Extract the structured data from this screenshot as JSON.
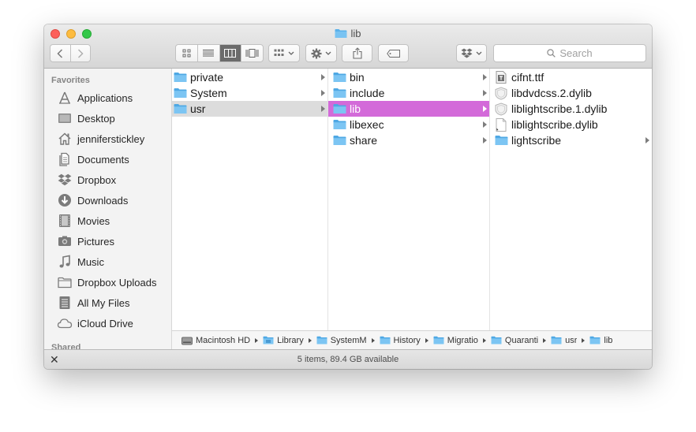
{
  "window": {
    "title": "lib"
  },
  "toolbar": {
    "search_placeholder": "Search"
  },
  "sidebar": {
    "favorites_heading": "Favorites",
    "shared_heading": "Shared",
    "items": [
      {
        "label": "Applications",
        "icon": "applications-icon"
      },
      {
        "label": "Desktop",
        "icon": "desktop-icon"
      },
      {
        "label": "jenniferstickley",
        "icon": "home-icon"
      },
      {
        "label": "Documents",
        "icon": "documents-icon"
      },
      {
        "label": "Dropbox",
        "icon": "dropbox-icon"
      },
      {
        "label": "Downloads",
        "icon": "downloads-icon"
      },
      {
        "label": "Movies",
        "icon": "movies-icon"
      },
      {
        "label": "Pictures",
        "icon": "pictures-icon"
      },
      {
        "label": "Music",
        "icon": "music-icon"
      },
      {
        "label": "Dropbox Uploads",
        "icon": "folder-icon"
      },
      {
        "label": "All My Files",
        "icon": "all-files-icon"
      },
      {
        "label": "iCloud Drive",
        "icon": "cloud-icon"
      }
    ]
  },
  "columns": [
    {
      "items": [
        {
          "name": "private",
          "type": "folder",
          "has_children": true,
          "selected": false
        },
        {
          "name": "System",
          "type": "folder",
          "has_children": true,
          "selected": false
        },
        {
          "name": "usr",
          "type": "folder",
          "has_children": true,
          "selected": true
        }
      ]
    },
    {
      "items": [
        {
          "name": "bin",
          "type": "folder",
          "has_children": true,
          "selected": false
        },
        {
          "name": "include",
          "type": "folder",
          "has_children": true,
          "selected": false
        },
        {
          "name": "lib",
          "type": "folder",
          "has_children": true,
          "selected": true
        },
        {
          "name": "libexec",
          "type": "folder",
          "has_children": true,
          "selected": false
        },
        {
          "name": "share",
          "type": "folder",
          "has_children": true,
          "selected": false
        }
      ]
    },
    {
      "items": [
        {
          "name": "cifnt.ttf",
          "type": "font",
          "has_children": false,
          "selected": false
        },
        {
          "name": "libdvdcss.2.dylib",
          "type": "dylib",
          "has_children": false,
          "selected": false
        },
        {
          "name": "liblightscribe.1.dylib",
          "type": "dylib",
          "has_children": false,
          "selected": false
        },
        {
          "name": "liblightscribe.dylib",
          "type": "doc",
          "has_children": false,
          "selected": false
        },
        {
          "name": "lightscribe",
          "type": "folder",
          "has_children": true,
          "selected": false
        }
      ]
    }
  ],
  "pathbar": [
    {
      "label": "Macintosh HD",
      "icon": "harddisk-icon"
    },
    {
      "label": "Library",
      "icon": "folder-icon"
    },
    {
      "label": "SystemM",
      "icon": "folder-icon"
    },
    {
      "label": "History",
      "icon": "folder-icon"
    },
    {
      "label": "Migratio",
      "icon": "folder-icon"
    },
    {
      "label": "Quaranti",
      "icon": "folder-icon"
    },
    {
      "label": "usr",
      "icon": "folder-icon"
    },
    {
      "label": "lib",
      "icon": "folder-icon"
    }
  ],
  "status": {
    "text": "5 items, 89.4 GB available"
  },
  "colors": {
    "selection_active": "#d36ad9",
    "selection_inactive": "#dcdcdc",
    "folder": "#5ab1ea"
  }
}
